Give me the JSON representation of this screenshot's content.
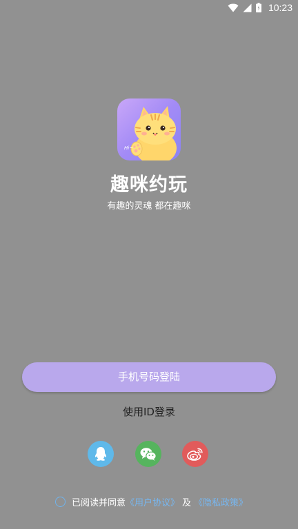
{
  "status_bar": {
    "time": "10:23",
    "icons": [
      "wifi-icon",
      "cellular-signal-icon",
      "battery-icon"
    ]
  },
  "app": {
    "name": "趣咪约玩",
    "slogan": "有趣的灵魂 都在趣咪",
    "logo_text": "Hi~"
  },
  "actions": {
    "phone_login_label": "手机号码登陆",
    "id_login_label": "使用ID登录"
  },
  "social": {
    "icons": [
      "qq-icon",
      "wechat-icon",
      "weibo-icon"
    ]
  },
  "agreement": {
    "prefix": "已阅读并同意",
    "user_agreement": "《用户协议》",
    "and": "及",
    "privacy_policy": "《隐私政策》"
  },
  "colors": {
    "background": "#919191",
    "primary_button": "#b9a8ec",
    "link": "#77b6ef",
    "qq": "#5fb9ea",
    "wechat": "#56b45e",
    "weibo": "#e15b5b"
  }
}
